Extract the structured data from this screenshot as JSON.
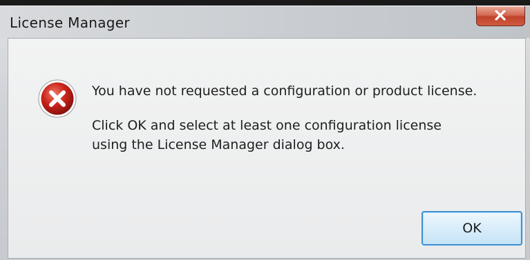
{
  "window": {
    "title": "License Manager"
  },
  "dialog": {
    "icon": "error-icon",
    "message_line1": "You have not requested a configuration or product license.",
    "message_line2": "Click OK and select at least one configuration license",
    "message_line3": "using the License Manager dialog box.",
    "ok_label": "OK"
  },
  "colors": {
    "error_red": "#c9241b",
    "close_red": "#c0432c",
    "focus_blue": "#3c8fd0"
  }
}
